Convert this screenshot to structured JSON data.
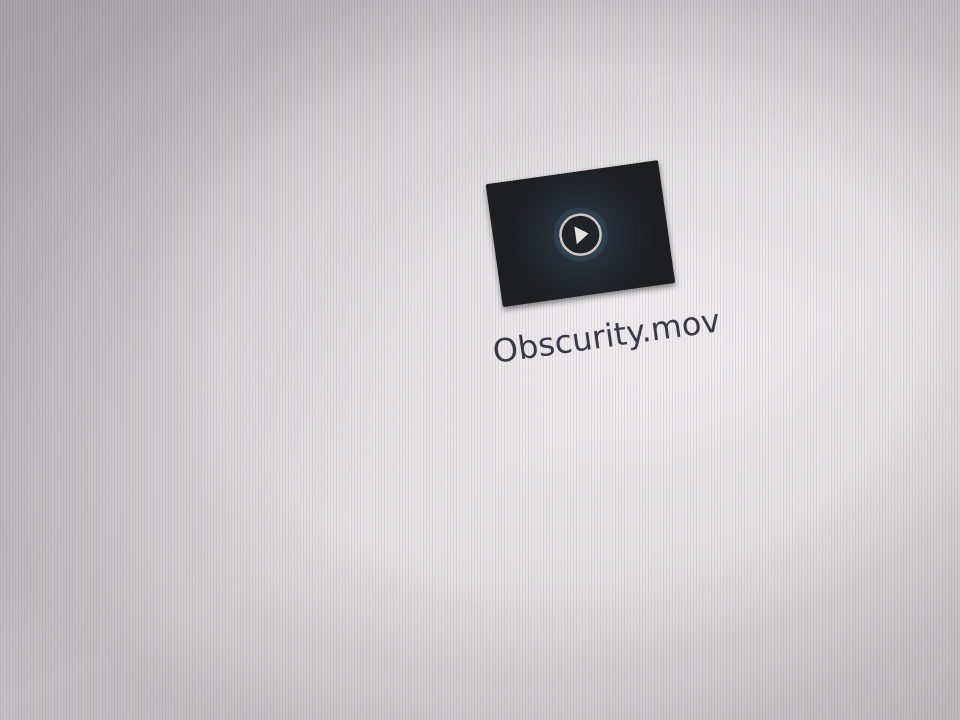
{
  "desktop": {
    "files": [
      {
        "name": "Obscurity.mov",
        "icon": "video-file-icon"
      }
    ]
  }
}
